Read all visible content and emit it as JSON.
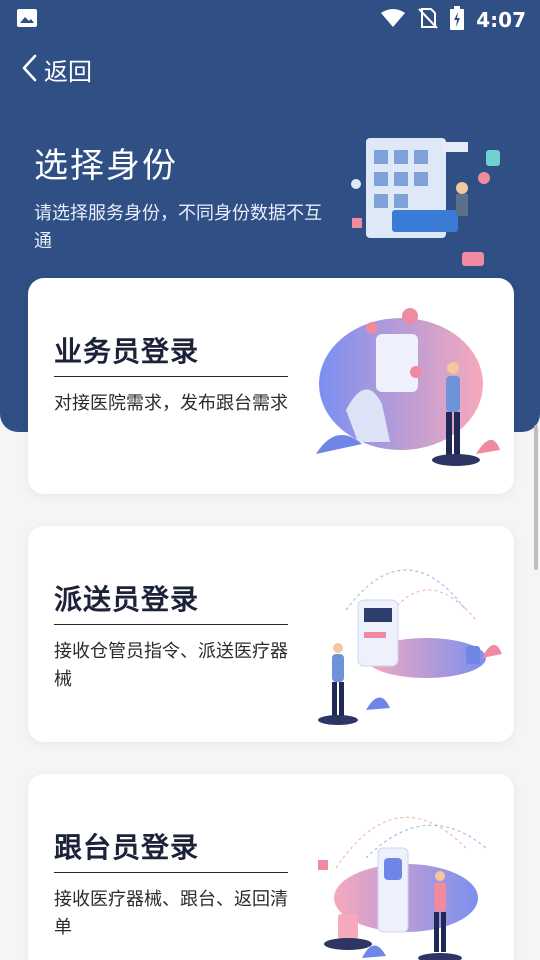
{
  "status_bar": {
    "time": "4:07"
  },
  "nav": {
    "back_label": "返回"
  },
  "header": {
    "title": "选择身份",
    "subtitle": "请选择服务身份，不同身份数据不互通"
  },
  "roles": [
    {
      "title": "业务员登录",
      "description": "对接医院需求，发布跟台需求"
    },
    {
      "title": "派送员登录",
      "description": "接收仓管员指令、派送医疗器械"
    },
    {
      "title": "跟台员登录",
      "description": "接收医疗器械、跟台、返回清单"
    }
  ],
  "colors": {
    "header_bg": "#2f4f85",
    "page_bg": "#f5f5f5",
    "accent_pink": "#f08aa0",
    "accent_blue": "#6d86e8"
  },
  "icons": [
    "image-icon",
    "wifi-icon",
    "no-sim-icon",
    "battery-icon",
    "back-chevron-icon"
  ]
}
